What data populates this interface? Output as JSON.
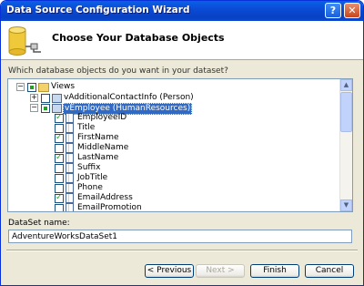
{
  "window": {
    "title": "Data Source Configuration Wizard",
    "help_glyph": "?",
    "close_glyph": "✕"
  },
  "header": {
    "title": "Choose Your Database Objects",
    "icon": "database-connect-icon"
  },
  "prompt": "Which database objects do you want in your dataset?",
  "tree": {
    "views_label": "Views",
    "views_collapse_glyph": "−",
    "items": [
      {
        "label": "vAdditionalContactInfo (Person)",
        "glyph": "+",
        "state": "unchecked"
      },
      {
        "label": "vEmployee (HumanResources)",
        "glyph": "−",
        "state": "partial",
        "selected": true
      }
    ],
    "fields": [
      {
        "label": "EmployeeID",
        "checked": true
      },
      {
        "label": "Title",
        "checked": false
      },
      {
        "label": "FirstName",
        "checked": true
      },
      {
        "label": "MiddleName",
        "checked": false
      },
      {
        "label": "LastName",
        "checked": true
      },
      {
        "label": "Suffix",
        "checked": false
      },
      {
        "label": "JobTitle",
        "checked": false
      },
      {
        "label": "Phone",
        "checked": false
      },
      {
        "label": "EmailAddress",
        "checked": true
      },
      {
        "label": "EmailPromotion",
        "checked": false
      }
    ],
    "scroll_up": "▲",
    "scroll_down": "▼"
  },
  "dataset": {
    "label": "DataSet name:",
    "value": "AdventureWorksDataSet1"
  },
  "buttons": {
    "previous": "< Previous",
    "next": "Next >",
    "finish": "Finish",
    "cancel": "Cancel"
  }
}
